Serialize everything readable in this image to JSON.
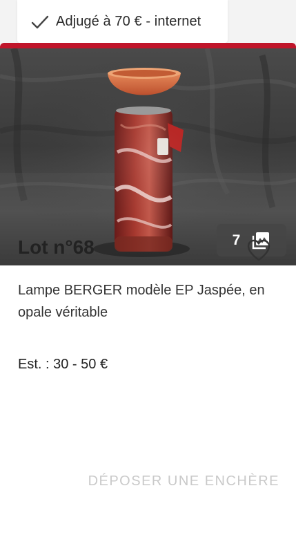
{
  "status": {
    "text": "Adjugé à 70 € - internet",
    "icon": "check-icon"
  },
  "accent_color": "#c0152a",
  "lot": {
    "title": "Lot n°68",
    "photo_count": "7",
    "photo_count_icon": "gallery-icon",
    "favorite_icon": "heart-outline-icon",
    "description": "Lampe BERGER modèle EP Jaspée, en opale véritable",
    "estimate": "Est. : 30 - 50 €"
  },
  "actions": {
    "bid_label": "DÉPOSER UNE ENCHÈRE"
  }
}
